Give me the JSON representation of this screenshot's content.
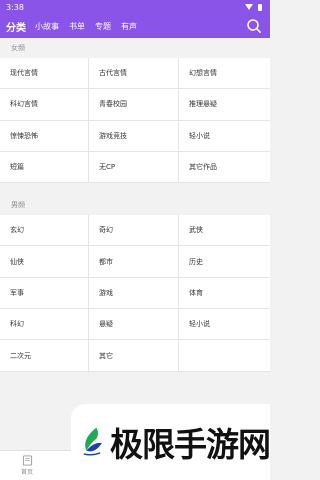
{
  "status": {
    "time": "3:38"
  },
  "tabs": [
    {
      "label": "分类"
    },
    {
      "label": "小故事"
    },
    {
      "label": "书单"
    },
    {
      "label": "专题"
    },
    {
      "label": "有声"
    }
  ],
  "sections": [
    {
      "title": "女频",
      "items": [
        "现代言情",
        "古代言情",
        "幻想言情",
        "科幻言情",
        "青春校园",
        "推理悬疑",
        "惊悚恐怖",
        "游戏竞技",
        "轻小说",
        "短篇",
        "无CP",
        "其它作品"
      ]
    },
    {
      "title": "男频",
      "items": [
        "玄幻",
        "奇幻",
        "武侠",
        "仙侠",
        "都市",
        "历史",
        "军事",
        "游戏",
        "体育",
        "科幻",
        "悬疑",
        "轻小说",
        "二次元",
        "其它",
        ""
      ]
    }
  ],
  "bottom_nav": {
    "home_label": "首页"
  },
  "watermark": {
    "text": "极限手游网"
  },
  "colors": {
    "primary": "#8a54e8",
    "logo_green": "#1faa55",
    "logo_blue": "#1f3fae"
  },
  "icons": [
    "wifi-icon",
    "battery-icon",
    "search-icon",
    "home-icon",
    "watermark-logo"
  ]
}
